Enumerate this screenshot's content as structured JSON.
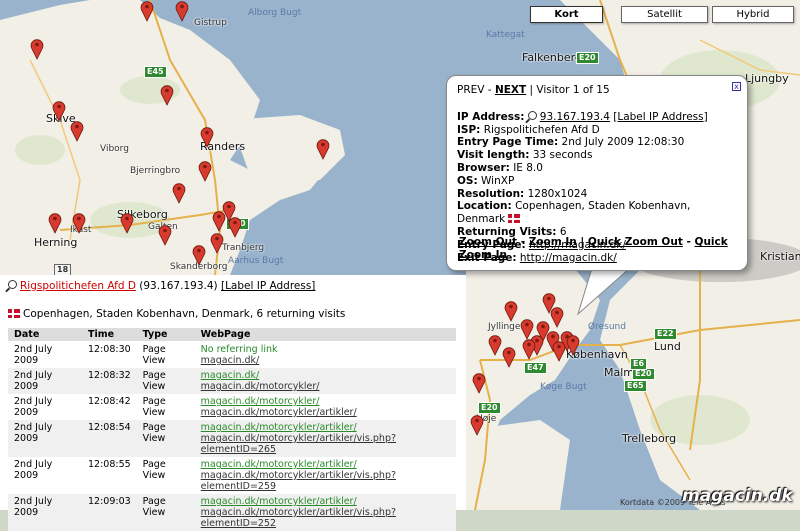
{
  "map_types": [
    {
      "label": "Kort",
      "active": true
    },
    {
      "label": "Satellit",
      "active": false
    },
    {
      "label": "Hybrid",
      "active": false
    }
  ],
  "map_labels": {
    "aalborg_bugt": "Alborg Bugt",
    "kattegat": "Kattegat",
    "falkenberg": "Falkenberg",
    "ljungby": "Ljungby",
    "skive": "Skive",
    "viborg": "Viborg",
    "randers": "Randers",
    "bjerringbro": "Bjerringbro",
    "herning": "Herning",
    "silkeborg": "Silkeborg",
    "galten": "Galten",
    "tranbjerg": "Tranbjerg",
    "skanderborg": "Skanderborg",
    "aarhus_bugt": "Aarhus Bugt",
    "ikast": "Ikast",
    "gistrup": "Gistrup",
    "kristianstad": "Kristiana",
    "jyllinge": "Jyllinge",
    "oresund": "Øresund",
    "kobenhavn": "København",
    "malmo": "Malmö",
    "koge_bugt": "Køge Bugt",
    "lund": "Lund",
    "trelleborg": "Trelleborg",
    "hoje": "Høje"
  },
  "road_labels": [
    "E45",
    "E20",
    "E22",
    "E20",
    "E47",
    "E65",
    "E20",
    "E20",
    "18",
    "E6"
  ],
  "popup": {
    "prev": "PREV",
    "sep": "-",
    "next": "NEXT",
    "visitor": "| Visitor 1 of 15",
    "close": "x",
    "ip_label": "IP Address:",
    "ip_value": "93.167.193.4",
    "ip_action": "[Label IP Address]",
    "isp_label": "ISP:",
    "isp_value": "Rigspolitichefen Afd D",
    "entry_time_label": "Entry Page Time:",
    "entry_time_value": "2nd July 2009 12:08:30",
    "visit_length_label": "Visit length:",
    "visit_length_value": "33 seconds",
    "browser_label": "Browser:",
    "browser_value": "IE 8.0",
    "os_label": "OS:",
    "os_value": "WinXP",
    "resolution_label": "Resolution:",
    "resolution_value": "1280x1024",
    "location_label": "Location:",
    "location_value": "Copenhagen, Staden Kobenhavn, Denmark",
    "returning_label": "Returning Visits:",
    "returning_value": "6",
    "entry_page_label": "Entry Page:",
    "entry_page_value": "http://magacin.dk/",
    "exit_page_label": "Exit Page:",
    "exit_page_value": "http://magacin.dk/",
    "zoom_out": "Zoom Out",
    "zoom_in": "Zoom In",
    "quick_zoom_out": "Quick Zoom Out",
    "quick_zoom_in": "Quick Zoom In",
    "dash": "-",
    "bar": "|"
  },
  "panel": {
    "isp": "Rigspolitichefen Afd D",
    "ip": "(93.167.193.4)",
    "label_ip": "[Label IP Address]",
    "location_line": "Copenhagen, Staden Kobenhavn, Denmark, 6 returning visits",
    "columns": [
      "Date",
      "Time",
      "Type",
      "WebPage"
    ],
    "rows": [
      {
        "date": "2nd July 2009",
        "time": "12:08:30",
        "type": "Page View",
        "page1": "No referring link",
        "page2": "magacin.dk/",
        "noref": true
      },
      {
        "date": "2nd July 2009",
        "time": "12:08:32",
        "type": "Page View",
        "page1": "magacin.dk/",
        "page2": "magacin.dk/motorcykler/",
        "noref": false
      },
      {
        "date": "2nd July 2009",
        "time": "12:08:42",
        "type": "Page View",
        "page1": "magacin.dk/motorcykler/",
        "page2": "magacin.dk/motorcykler/artikler/",
        "noref": false
      },
      {
        "date": "2nd July 2009",
        "time": "12:08:54",
        "type": "Page View",
        "page1": "magacin.dk/motorcykler/artikler/",
        "page2": "magacin.dk/motorcykler/artikler/vis.php?elementID=265",
        "noref": false
      },
      {
        "date": "2nd July 2009",
        "time": "12:08:55",
        "type": "Page View",
        "page1": "magacin.dk/motorcykler/artikler/",
        "page2": "magacin.dk/motorcykler/artikler/vis.php?elementID=259",
        "noref": false
      },
      {
        "date": "2nd July 2009",
        "time": "12:09:03",
        "type": "Page View",
        "page1": "magacin.dk/motorcykler/artikler/",
        "page2": "magacin.dk/motorcykler/artikler/vis.php?elementID=252",
        "noref": false
      }
    ]
  },
  "copyright": "Kortdata ©2009 Tele Atlas",
  "watermark": "magacin.dk",
  "colors": {
    "pin": "#d93a2e",
    "land": "#f2efe6",
    "water": "#99b3cc",
    "green": "#cfe3b8"
  }
}
